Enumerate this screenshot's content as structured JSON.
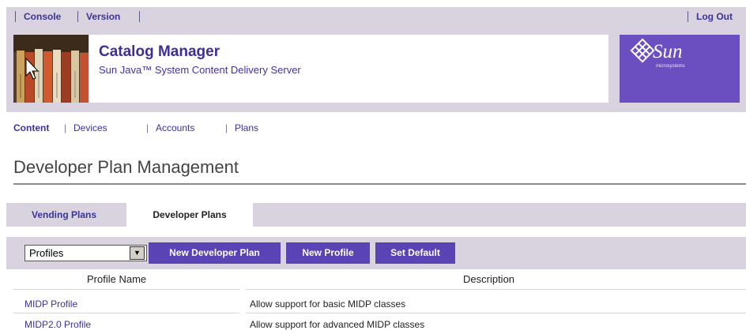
{
  "top_links": {
    "console": "Console",
    "version": "Version",
    "logout": "Log Out"
  },
  "header": {
    "app_title": "Catalog Manager",
    "subtitle": "Sun Java™ System Content Delivery Server",
    "logo_word": "Sun",
    "logo_small": "microsystems"
  },
  "nav": {
    "items": [
      {
        "label": "Content",
        "active": true
      },
      {
        "label": "Devices",
        "active": false
      },
      {
        "label": "Accounts",
        "active": false
      },
      {
        "label": "Plans",
        "active": false
      }
    ]
  },
  "page_title": "Developer Plan Management",
  "tabs": [
    {
      "label": "Vending Plans",
      "active": false
    },
    {
      "label": "Developer Plans",
      "active": true
    }
  ],
  "toolbar": {
    "select_value": "Profiles",
    "buttons": [
      "New Developer Plan",
      "New Profile",
      "Set Default"
    ]
  },
  "table": {
    "columns": [
      "Profile Name",
      "Description"
    ],
    "rows": [
      {
        "name": "MIDP Profile",
        "description": "Allow support for basic MIDP classes"
      },
      {
        "name": "MIDP2.0 Profile",
        "description": "Allow support for advanced MIDP classes"
      }
    ]
  },
  "colors": {
    "accent": "#5943b5",
    "link": "#3a3399",
    "band": "#d9d3df"
  }
}
